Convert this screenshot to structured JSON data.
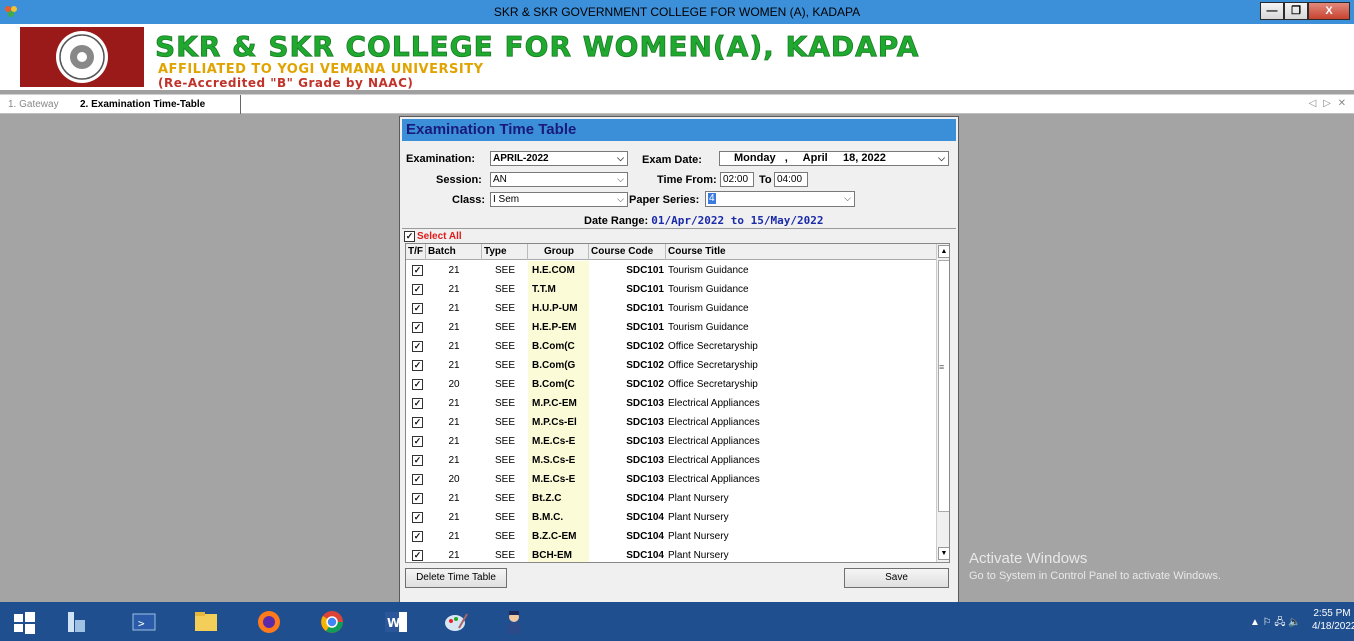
{
  "window": {
    "title": "SKR & SKR GOVERNMENT COLLEGE FOR WOMEN (A), KADAPA",
    "min_label": "—",
    "max_label": "❐",
    "close_label": "X"
  },
  "banner": {
    "title": "SKR & SKR COLLEGE FOR WOMEN(A), KADAPA",
    "subtitle": "AFFILIATED TO YOGI VEMANA UNIVERSITY",
    "accreditation": "(Re-Accredited \"B\" Grade by NAAC)",
    "colors": {
      "title": "#1faa2f",
      "subtitle": "#e0a300",
      "accreditation": "#c0332b"
    }
  },
  "tabs": [
    {
      "label": "1. Gateway"
    },
    {
      "label": "2. Examination Time-Table"
    }
  ],
  "tab_nav": "◁ ▷ ✕",
  "dialog": {
    "title": "Examination Time Table",
    "examination_label": "Examination:",
    "examination_value": "APRIL-2022",
    "exam_date_label": "Exam Date:",
    "exam_date_value": "Monday   ,     April     18, 2022",
    "session_label": "Session:",
    "session_value": "AN",
    "time_from_label": "Time From:",
    "time_from_value": "02:00",
    "to_label": "To",
    "time_to_value": "04:00",
    "class_label": "Class:",
    "class_value": "I Sem",
    "paper_series_label": "Paper Series:",
    "paper_series_value": "4",
    "date_range_label": "Date Range:",
    "date_range_value": "01/Apr/2022 to 15/May/2022",
    "select_all_label": "Select All",
    "columns": [
      "T/F",
      "Batch",
      "Type",
      "Group",
      "Course Code",
      "Course Title"
    ],
    "rows": [
      {
        "batch": "21",
        "type": "SEE",
        "group": "H.E.COM",
        "code": "SDC101",
        "title": "Tourism Guidance"
      },
      {
        "batch": "21",
        "type": "SEE",
        "group": "T.T.M",
        "code": "SDC101",
        "title": "Tourism Guidance"
      },
      {
        "batch": "21",
        "type": "SEE",
        "group": "H.U.P-UM",
        "code": "SDC101",
        "title": "Tourism Guidance"
      },
      {
        "batch": "21",
        "type": "SEE",
        "group": "H.E.P-EM",
        "code": "SDC101",
        "title": "Tourism Guidance"
      },
      {
        "batch": "21",
        "type": "SEE",
        "group": "B.Com(C",
        "code": "SDC102",
        "title": "Office Secretaryship"
      },
      {
        "batch": "21",
        "type": "SEE",
        "group": "B.Com(G",
        "code": "SDC102",
        "title": "Office Secretaryship"
      },
      {
        "batch": "20",
        "type": "SEE",
        "group": "B.Com(C",
        "code": "SDC102",
        "title": "Office Secretaryship"
      },
      {
        "batch": "21",
        "type": "SEE",
        "group": "M.P.C-EM",
        "code": "SDC103",
        "title": "Electrical Appliances"
      },
      {
        "batch": "21",
        "type": "SEE",
        "group": "M.P.Cs-El",
        "code": "SDC103",
        "title": "Electrical Appliances"
      },
      {
        "batch": "21",
        "type": "SEE",
        "group": "M.E.Cs-E",
        "code": "SDC103",
        "title": "Electrical Appliances"
      },
      {
        "batch": "21",
        "type": "SEE",
        "group": "M.S.Cs-E",
        "code": "SDC103",
        "title": "Electrical Appliances"
      },
      {
        "batch": "20",
        "type": "SEE",
        "group": "M.E.Cs-E",
        "code": "SDC103",
        "title": "Electrical Appliances"
      },
      {
        "batch": "21",
        "type": "SEE",
        "group": "Bt.Z.C",
        "code": "SDC104",
        "title": "Plant Nursery"
      },
      {
        "batch": "21",
        "type": "SEE",
        "group": "B.M.C.",
        "code": "SDC104",
        "title": "Plant Nursery"
      },
      {
        "batch": "21",
        "type": "SEE",
        "group": "B.Z.C-EM",
        "code": "SDC104",
        "title": "Plant Nursery"
      },
      {
        "batch": "21",
        "type": "SEE",
        "group": "BCH-EM",
        "code": "SDC104",
        "title": "Plant Nursery"
      }
    ],
    "delete_button": "Delete Time Table",
    "save_button": "Save"
  },
  "watermark": {
    "line1": "Activate Windows",
    "line2": "Go to System in Control Panel to activate Windows."
  },
  "taskbar": {
    "time": "2:55 PM",
    "date": "4/18/2022",
    "tray": "▲  ⚐  🖧  🔈"
  }
}
